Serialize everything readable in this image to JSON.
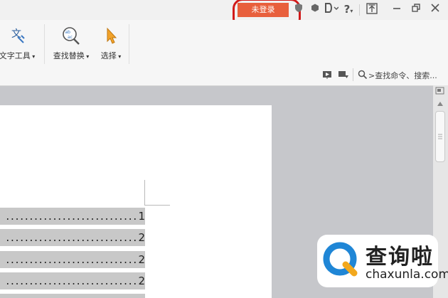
{
  "titlebar": {
    "login_label": "未登录",
    "icons": [
      "shield-icon",
      "skin-icon",
      "help-icon",
      "upload-icon",
      "minimize-icon",
      "restore-icon",
      "close-icon"
    ],
    "help_label": "?"
  },
  "ribbon": {
    "text_tools_label": "文字工具",
    "find_replace_label": "查找替换",
    "select_label": "选择",
    "search_placeholder": "查找命令、搜索..."
  },
  "document": {
    "toc_lines": [
      {
        "dots": "............................",
        "page": "1"
      },
      {
        "dots": "............................",
        "page": "2"
      },
      {
        "dots": "............................",
        "page": "2"
      },
      {
        "dots": "............................",
        "page": "2"
      }
    ]
  },
  "watermark": {
    "brand_cn": "查询啦",
    "brand_en": "chaxunla.com"
  },
  "colors": {
    "accent": "#e85f3c",
    "highlight_ring": "#d11a1a"
  }
}
